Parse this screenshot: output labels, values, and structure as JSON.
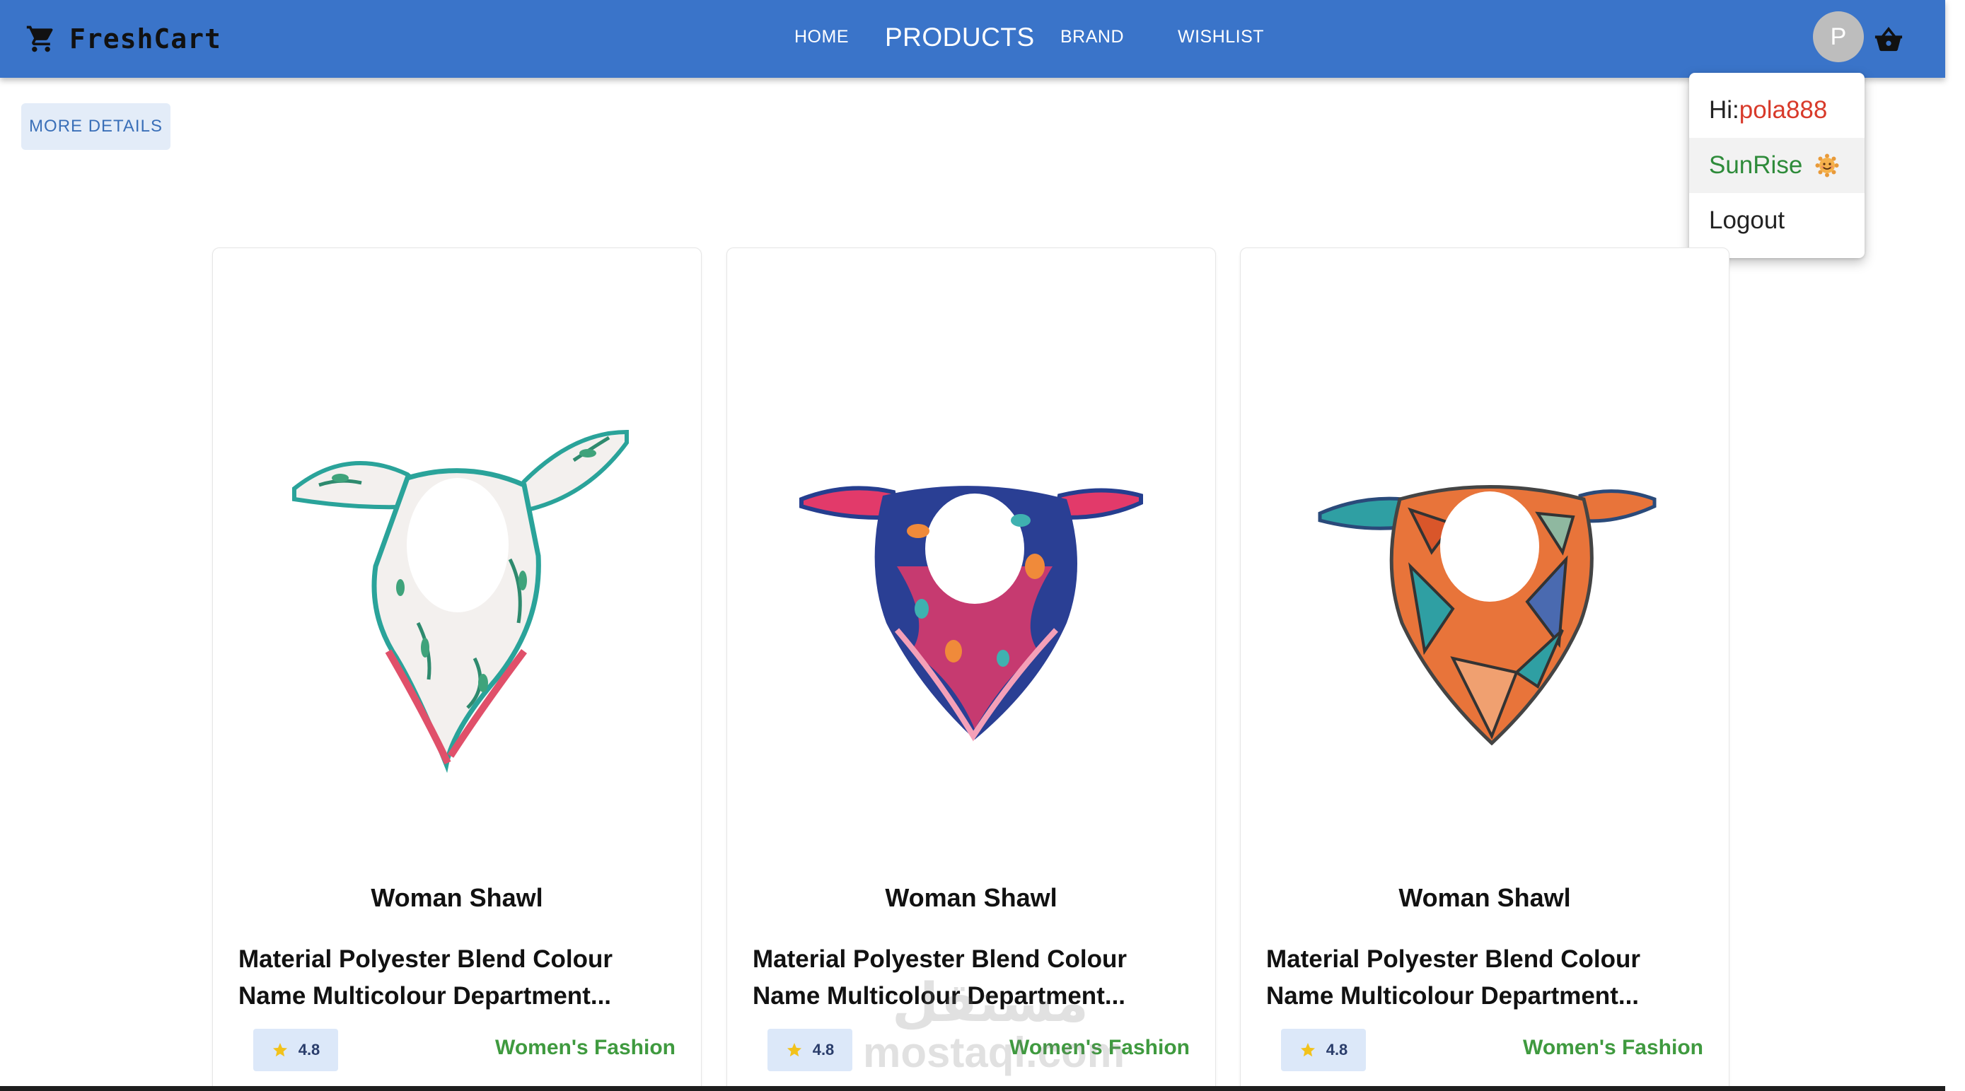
{
  "app": {
    "brand_name": "FreshCart",
    "cart_icon": "cart-icon",
    "basket_icon": "basket-icon"
  },
  "nav": {
    "home": "HOME",
    "products": "PRODUCTS",
    "brand": "BRAND",
    "wishlist": "WISHLIST",
    "active": "PRODUCTS"
  },
  "user": {
    "avatar_initial": "P",
    "menu": {
      "greeting_prefix": "Hi:",
      "username": "pola888",
      "sunrise_label": "SunRise",
      "sunrise_icon": "smiling-sun-icon",
      "logout_label": "Logout"
    }
  },
  "actions": {
    "more_details_label": "MORE DETAILS"
  },
  "products": [
    {
      "title": "Woman Shawl",
      "description": "Material Polyester Blend Colour Name Multicolour Department...",
      "rating": "4.8",
      "category": "Women's Fashion",
      "image": "white-floral-scarf-image"
    },
    {
      "title": "Woman Shawl",
      "description": "Material Polyester Blend Colour Name Multicolour Department...",
      "rating": "4.8",
      "category": "Women's Fashion",
      "image": "navy-pink-floral-scarf-image"
    },
    {
      "title": "Woman Shawl",
      "description": "Material Polyester Blend Colour Name Multicolour Department...",
      "rating": "4.8",
      "category": "Women's Fashion",
      "image": "orange-teal-geometric-scarf-image"
    }
  ],
  "watermark": {
    "arabic": "مستقل",
    "latin": "mostaql.com"
  },
  "colors": {
    "appbar": "#3a74c9",
    "category_green": "#3f9a3f",
    "username_red": "#d83a2a",
    "rating_bg": "#dce8f9",
    "button_bg": "#e3ecf8"
  }
}
